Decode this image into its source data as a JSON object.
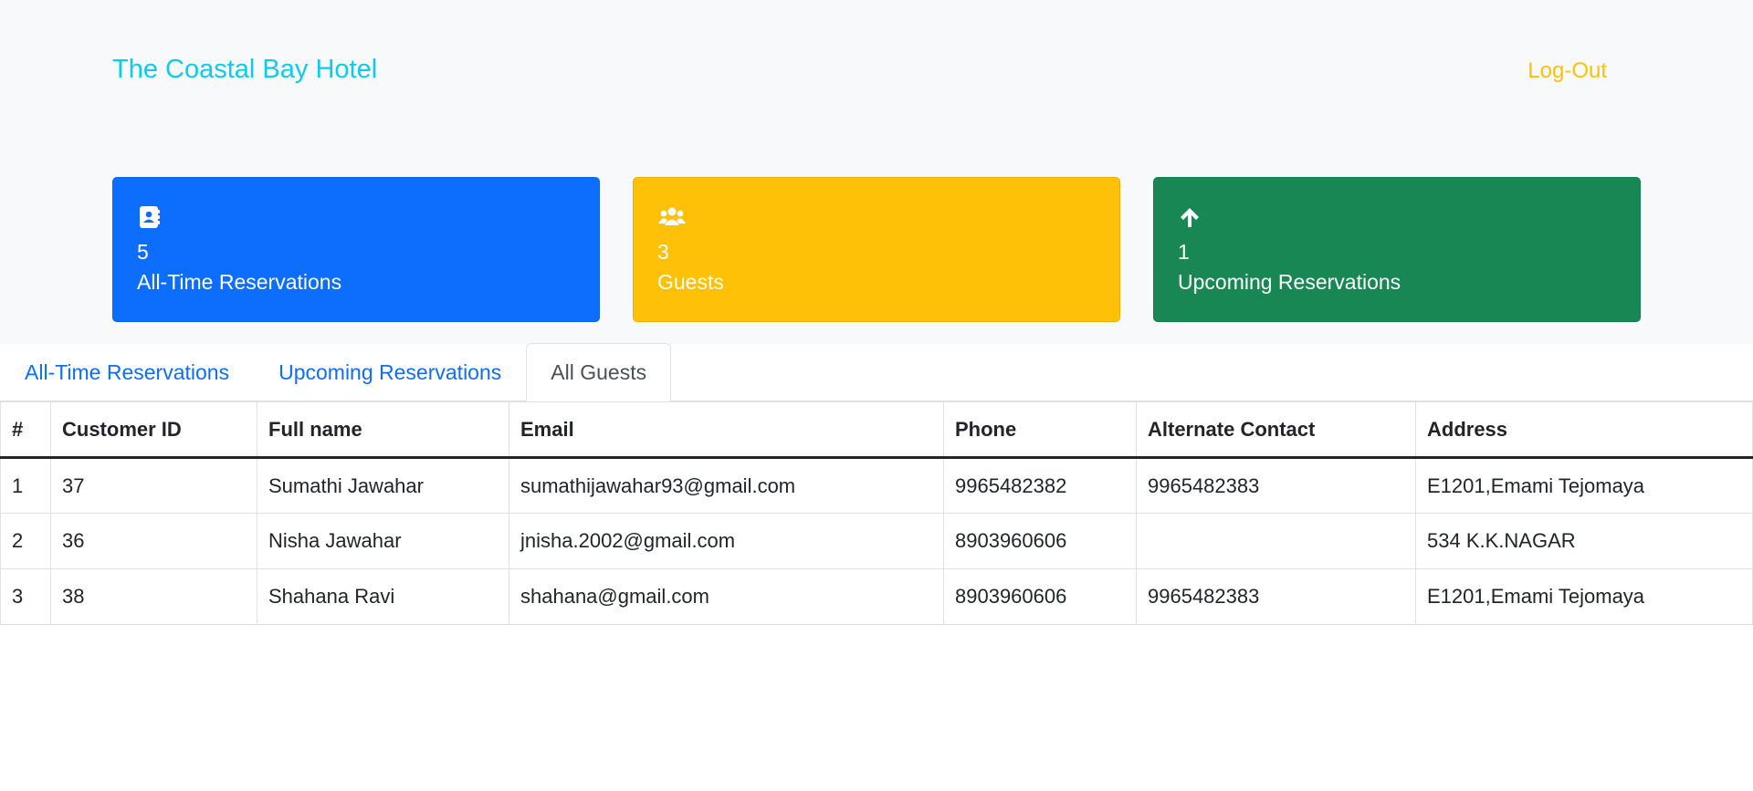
{
  "header": {
    "brand": "The Coastal Bay Hotel",
    "logout": "Log-Out"
  },
  "cards": [
    {
      "icon": "contact-book-icon",
      "count": "5",
      "label": "All-Time Reservations",
      "color": "#0d6efd"
    },
    {
      "icon": "users-icon",
      "count": "3",
      "label": "Guests",
      "color": "#ffc107"
    },
    {
      "icon": "arrow-up-icon",
      "count": "1",
      "label": "Upcoming Reservations",
      "color": "#198754"
    }
  ],
  "tabs": [
    {
      "label": "All-Time Reservations",
      "active": false
    },
    {
      "label": "Upcoming Reservations",
      "active": false
    },
    {
      "label": "All Guests",
      "active": true
    }
  ],
  "table": {
    "headers": [
      "#",
      "Customer ID",
      "Full name",
      "Email",
      "Phone",
      "Alternate Contact",
      "Address"
    ],
    "rows": [
      [
        "1",
        "37",
        "Sumathi Jawahar",
        "sumathijawahar93@gmail.com",
        "9965482382",
        "9965482383",
        "E1201,Emami Tejomaya"
      ],
      [
        "2",
        "36",
        "Nisha Jawahar",
        "jnisha.2002@gmail.com",
        "8903960606",
        "",
        "534 K.K.NAGAR"
      ],
      [
        "3",
        "38",
        "Shahana Ravi",
        "shahana@gmail.com",
        "8903960606",
        "9965482383",
        "E1201,Emami Tejomaya"
      ]
    ]
  }
}
